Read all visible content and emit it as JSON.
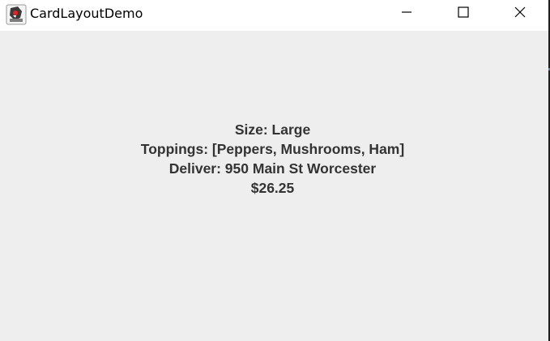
{
  "window": {
    "title": "CardLayoutDemo",
    "icon": "java-duke-icon"
  },
  "title_bar": {
    "buttons": [
      "minimize-icon",
      "maximize-icon",
      "close-icon"
    ]
  },
  "order_summary": {
    "size": "Size: Large",
    "toppings": "Toppings: [Peppers, Mushrooms, Ham]",
    "deliver": "Deliver: 950 Main St Worcester",
    "price": "$26.25"
  }
}
